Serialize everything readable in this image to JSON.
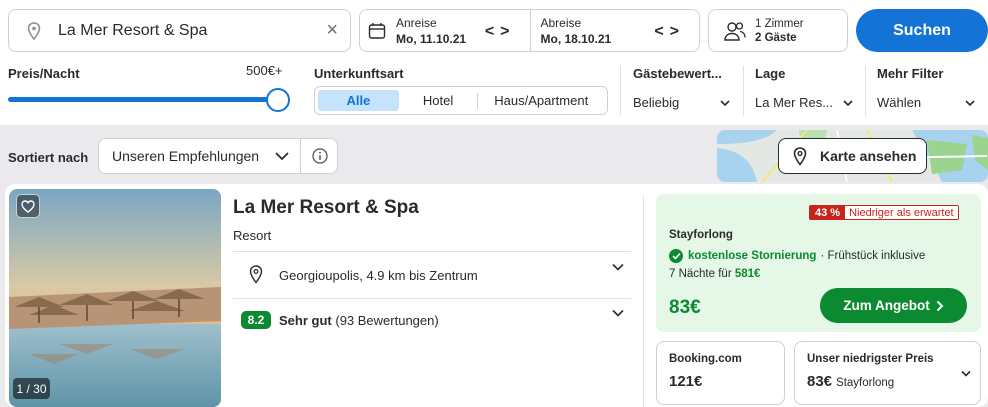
{
  "search": {
    "destination": "La Mer Resort & Spa",
    "checkin_label": "Anreise",
    "checkin_value": "Mo, 11.10.21",
    "checkout_label": "Abreise",
    "checkout_value": "Mo, 18.10.21",
    "rooms": "1 Zimmer",
    "guests": "2 Gäste",
    "search_button": "Suchen"
  },
  "filters": {
    "price_label": "Preis/Nacht",
    "price_max": "500€+",
    "price_slider_fraction": 1.0,
    "type_label": "Unterkunftsart",
    "type_options": [
      "Alle",
      "Hotel",
      "Haus/Apartment"
    ],
    "type_selected": "Alle",
    "rating_label": "Gästebewert...",
    "rating_value": "Beliebig",
    "location_label": "Lage",
    "location_value": "La Mer Res...",
    "more_label": "Mehr Filter",
    "more_value": "Wählen"
  },
  "sort": {
    "label": "Sortiert nach",
    "value": "Unseren Empfehlungen"
  },
  "map": {
    "button": "Karte ansehen"
  },
  "result": {
    "name": "La Mer Resort & Spa",
    "type": "Resort",
    "location": "Georgioupolis, 4.9 km bis Zentrum",
    "rating_score": "8.2",
    "rating_text": "Sehr gut",
    "rating_count": "(93 Bewertungen)",
    "photo_counter": "1 / 30",
    "offer": {
      "discount": "43 %",
      "discount_text": "Niedriger als erwartet",
      "provider": "Stayforlong",
      "cancellation": "kostenlose Stornierung",
      "extra": "· Frühstück inklusive",
      "nights_prefix": "7 Nächte für",
      "nights_total": "581€",
      "price": "83€",
      "button": "Zum Angebot"
    },
    "alt_offers": [
      {
        "provider": "Booking.com",
        "price": "121€"
      },
      {
        "title": "Unser niedrigster Preis",
        "price": "83€",
        "provider": "Stayforlong"
      }
    ]
  },
  "colors": {
    "primary_blue": "#1473d6",
    "deal_green": "#0c8a31",
    "offer_bg": "#e5f7e7",
    "discount_red": "#c4261d"
  }
}
